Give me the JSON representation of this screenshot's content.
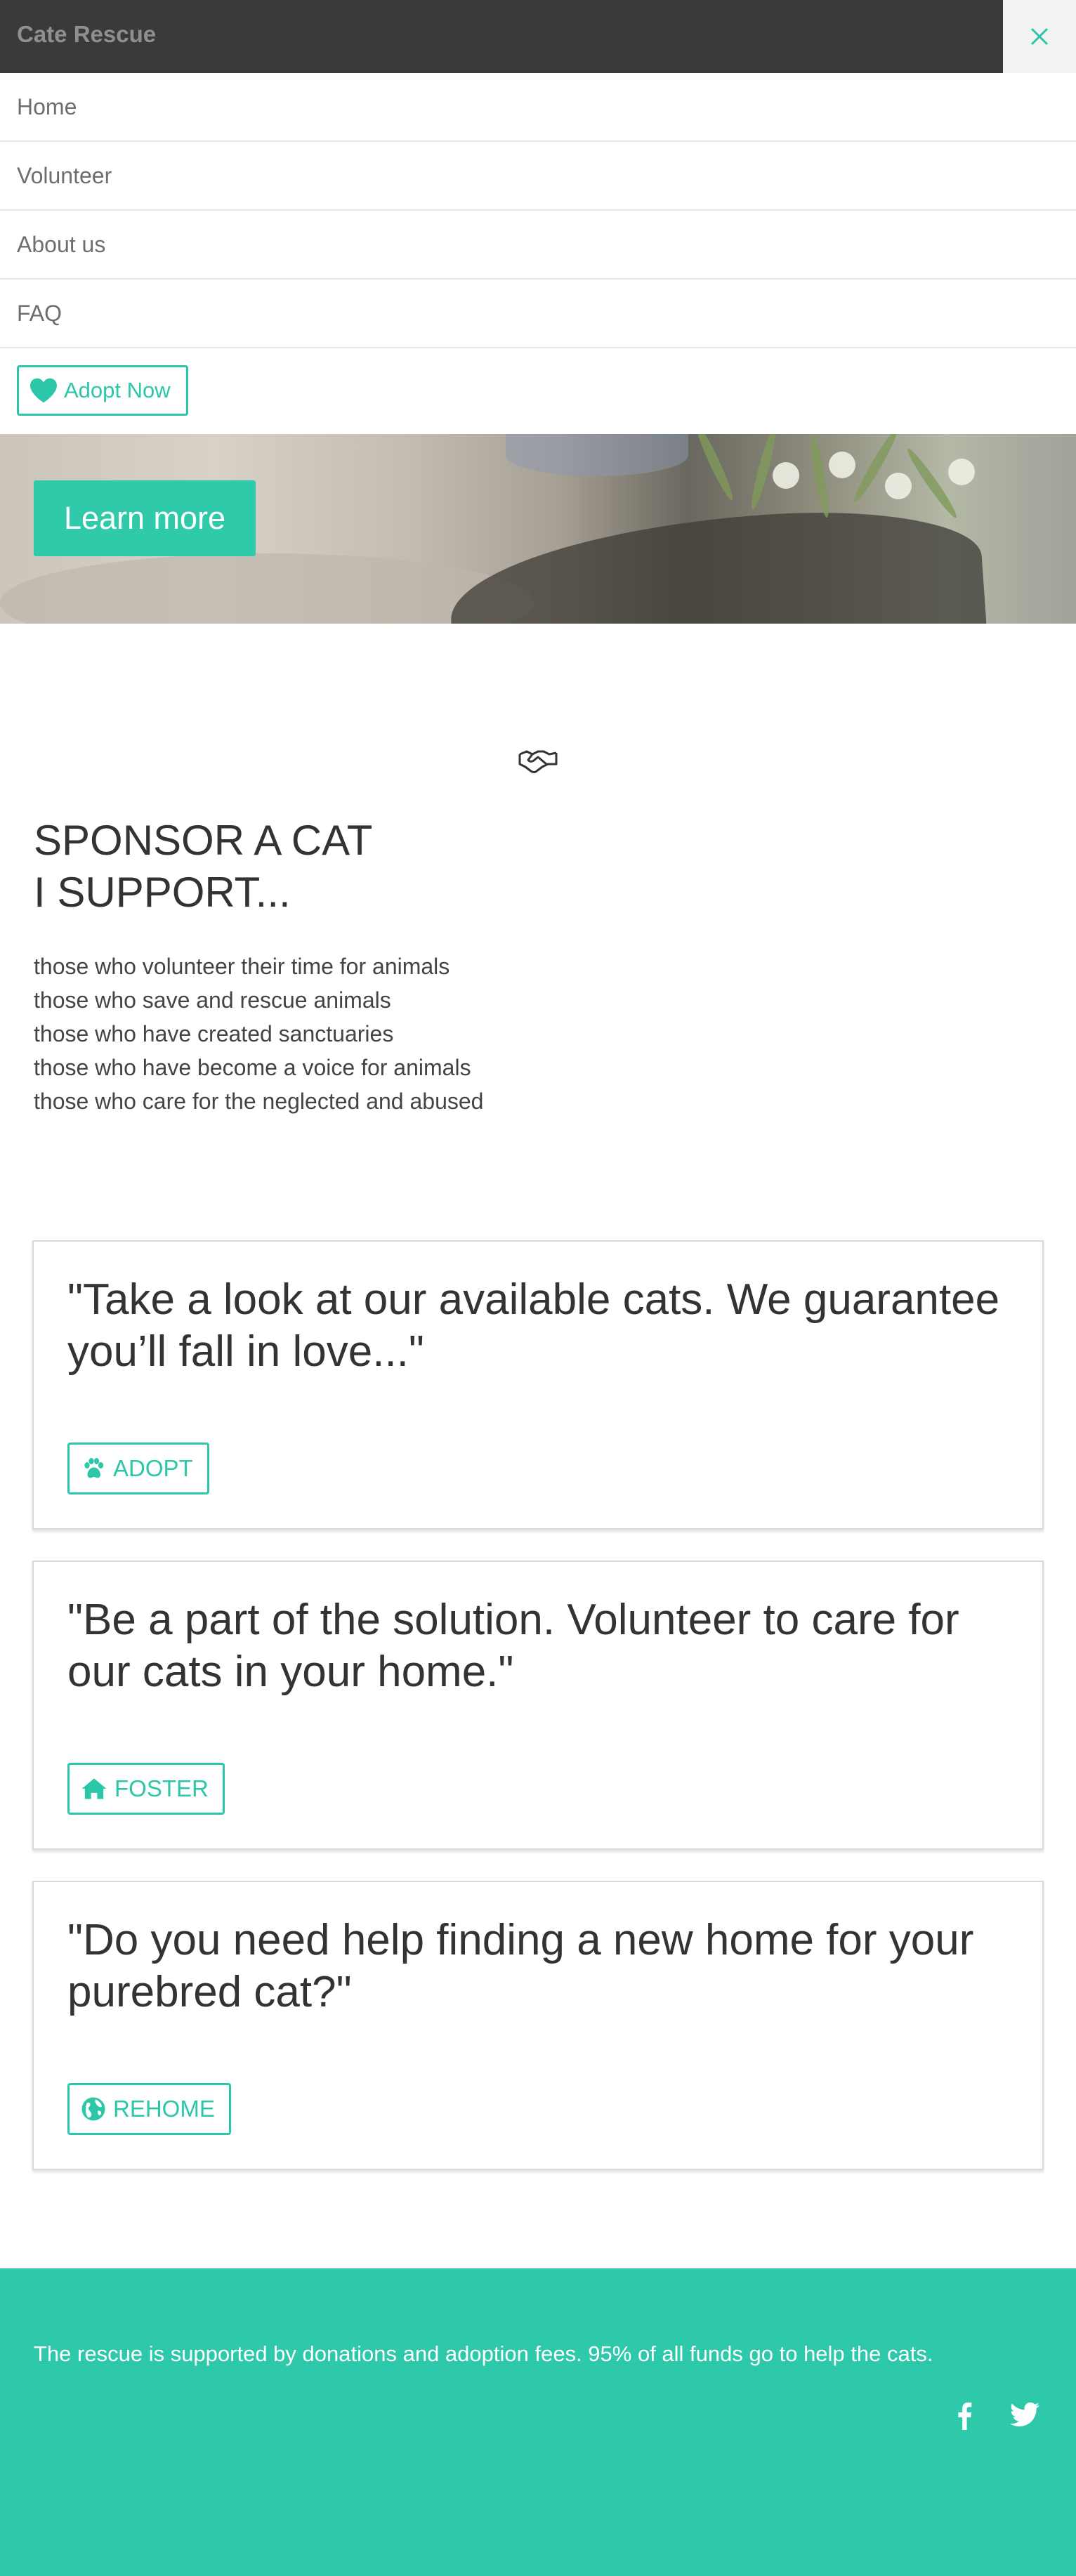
{
  "header": {
    "brand": "Cate Rescue",
    "close_icon": "close-icon"
  },
  "nav": {
    "items": [
      {
        "label": "Home"
      },
      {
        "label": "Volunteer"
      },
      {
        "label": "About us"
      },
      {
        "label": "FAQ"
      }
    ],
    "adopt_button": {
      "label": "Adopt Now",
      "icon": "heart-icon"
    }
  },
  "hero": {
    "button_label": "Learn more"
  },
  "sponsor": {
    "icon": "handshake-icon",
    "title_line1": "SPONSOR A CAT",
    "title_line2": "I SUPPORT...",
    "list": [
      "those who volunteer their time for animals",
      "those who save and rescue animals",
      "those who have created sanctuaries",
      "those who have become a voice for animals",
      "those who care for the neglected and abused"
    ]
  },
  "cards": [
    {
      "quote": "\"Take a look at our available cats. We guarantee you’ll fall in love...\"",
      "button": "ADOPT",
      "icon": "paw-icon"
    },
    {
      "quote": "\"Be a part of the solution. Volunteer to care for our cats in your home.\"",
      "button": "FOSTER",
      "icon": "home-icon"
    },
    {
      "quote": "\"Do you need help finding a new home for your purebred cat?\"",
      "button": "REHOME",
      "icon": "globe-icon"
    }
  ],
  "footer": {
    "text": "The rescue is supported by donations and adoption fees. 95% of all funds go to help the cats.",
    "social": [
      "facebook-icon",
      "twitter-icon"
    ]
  },
  "colors": {
    "accent": "#2ec8aa",
    "topbar": "#3a3a3a",
    "text": "#333333"
  }
}
